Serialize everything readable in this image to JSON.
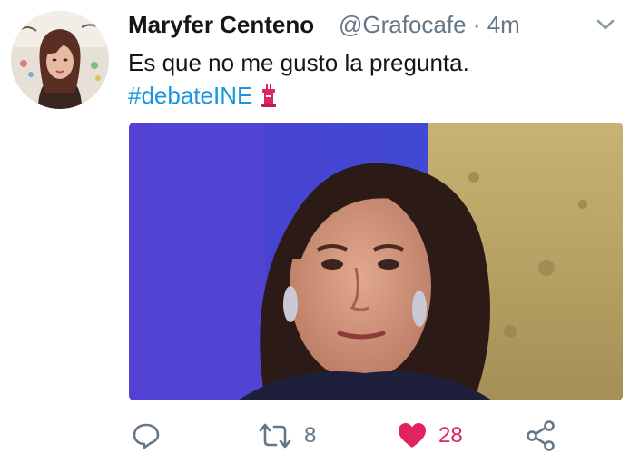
{
  "tweet": {
    "display_name": "Maryfer Centeno",
    "handle": "@Grafocafe",
    "separator": "·",
    "time": "4m",
    "text": "Es que no me gusto la pregunta.",
    "hashtag": "#debateINE"
  },
  "actions": {
    "retweet_count": "8",
    "like_count": "28",
    "like_active": true
  },
  "icons": {
    "reply": "reply-icon",
    "retweet": "retweet-icon",
    "like": "heart-icon",
    "share": "share-icon",
    "caret": "chevron-down-icon",
    "emoji": "podium-icon"
  },
  "colors": {
    "link": "#1b95e0",
    "muted": "#657786",
    "like": "#e0245e",
    "text": "#14171a"
  }
}
